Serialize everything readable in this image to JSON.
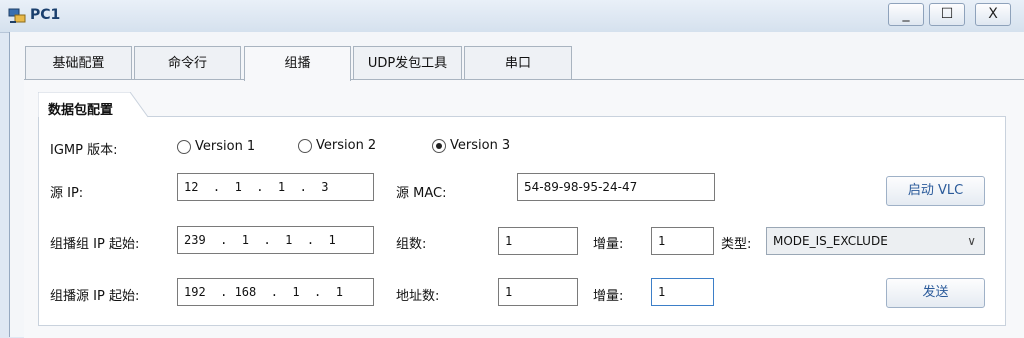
{
  "window": {
    "title": "PC1",
    "minimize": "_",
    "maximize": "☐",
    "close": "X"
  },
  "tabs": [
    {
      "label": "基础配置"
    },
    {
      "label": "命令行"
    },
    {
      "label": "组播"
    },
    {
      "label": "UDP发包工具"
    },
    {
      "label": "串口"
    }
  ],
  "active_tab": "组播",
  "group": {
    "title": "数据包配置"
  },
  "igmp": {
    "label": "IGMP 版本:",
    "options": [
      "Version 1",
      "Version 2",
      "Version 3"
    ],
    "selected": "Version 3"
  },
  "source_ip": {
    "label": "源 IP:",
    "value": "12  .  1  .  1  .  3"
  },
  "source_mac": {
    "label": "源  MAC:",
    "value": "54-89-98-95-24-47"
  },
  "vlc_button": "启动 VLC",
  "group_ip": {
    "label": "组播组 IP 起始:",
    "value": "239  .  1  .  1  .  1"
  },
  "group_count": {
    "label": "组数:",
    "value": "1"
  },
  "group_incr": {
    "label": "增量:",
    "value": "1"
  },
  "type": {
    "label": "类型:",
    "value": "MODE_IS_EXCLUDE"
  },
  "source_start": {
    "label": "组播源 IP 起始:",
    "value": "192  . 168  .  1  .  1"
  },
  "addr_count": {
    "label": "地址数:",
    "value": "1"
  },
  "addr_incr": {
    "label": "增量:",
    "value": "1"
  },
  "send_button": "发送"
}
